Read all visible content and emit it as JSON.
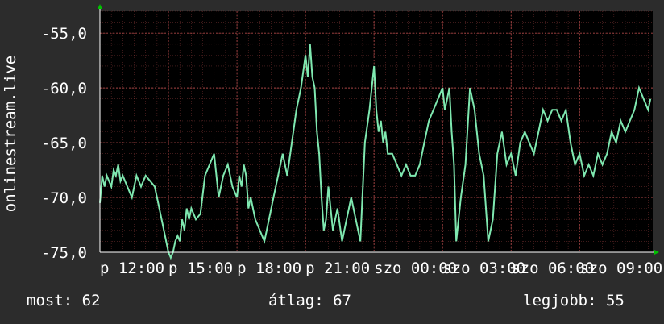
{
  "colors": {
    "background": "#2c2c2c",
    "plot_background": "#000000",
    "line": "#7fe8b0",
    "grid": "#b84c4c",
    "axis": "#ffffff",
    "arrow": "#00c000"
  },
  "stats": {
    "current": "most: 62",
    "average": "átlag: 67",
    "best": "legjobb: 55"
  },
  "chart_data": {
    "type": "line",
    "title": "",
    "xlabel": "",
    "ylabel": "onlinestream.live",
    "ylim": [
      -75,
      -53
    ],
    "y_ticks": [
      -55,
      -60,
      -65,
      -70,
      -75
    ],
    "y_tick_labels": [
      "-55,0",
      "-60,0",
      "-65,0",
      "-70,0",
      "-75,0"
    ],
    "x_tick_labels": [
      "p 12:00",
      "p 15:00",
      "p 18:00",
      "p 21:00",
      "szo 00:00",
      "szo 03:00",
      "szo 06:00",
      "szo 09:00"
    ],
    "x_tick_hours": [
      0,
      3,
      6,
      9,
      12,
      15,
      18,
      21
    ],
    "x_range_hours": [
      0,
      24.2
    ],
    "grid": true,
    "series": [
      {
        "name": "",
        "x_hours": [
          0,
          0.1,
          0.2,
          0.3,
          0.4,
          0.5,
          0.6,
          0.7,
          0.8,
          0.9,
          1.0,
          1.2,
          1.4,
          1.6,
          1.8,
          2.0,
          2.2,
          2.4,
          2.6,
          2.8,
          3.0,
          3.1,
          3.2,
          3.3,
          3.4,
          3.5,
          3.6,
          3.7,
          3.8,
          3.9,
          4.0,
          4.2,
          4.4,
          4.6,
          4.8,
          5.0,
          5.2,
          5.4,
          5.6,
          5.8,
          6.0,
          6.1,
          6.2,
          6.3,
          6.4,
          6.5,
          6.6,
          6.8,
          7.0,
          7.2,
          7.4,
          7.6,
          7.8,
          8.0,
          8.2,
          8.4,
          8.6,
          8.8,
          9.0,
          9.1,
          9.2,
          9.3,
          9.4,
          9.5,
          9.6,
          9.7,
          9.8,
          9.9,
          10.0,
          10.2,
          10.4,
          10.6,
          10.8,
          11.0,
          11.2,
          11.4,
          11.6,
          11.8,
          12.0,
          12.1,
          12.2,
          12.3,
          12.4,
          12.5,
          12.6,
          12.8,
          13.0,
          13.2,
          13.4,
          13.6,
          13.8,
          14.0,
          14.2,
          14.4,
          14.6,
          14.8,
          15.0,
          15.1,
          15.2,
          15.3,
          15.4,
          15.5,
          15.6,
          15.8,
          16.0,
          16.2,
          16.4,
          16.6,
          16.8,
          17.0,
          17.2,
          17.4,
          17.6,
          17.8,
          18.0,
          18.2,
          18.4,
          18.6,
          18.8,
          19.0,
          19.2,
          19.4,
          19.6,
          19.8,
          20.0,
          20.2,
          20.4,
          20.6,
          20.8,
          21.0,
          21.2,
          21.4,
          21.6,
          21.8,
          22.0,
          22.2,
          22.4,
          22.6,
          22.8,
          23.0,
          23.2,
          23.4,
          23.6,
          23.8,
          24.0,
          24.1
        ],
        "values": [
          -70.5,
          -68,
          -69,
          -68,
          -68.5,
          -69,
          -67.5,
          -68,
          -67,
          -68.5,
          -68,
          -69,
          -70,
          -68,
          -69,
          -68,
          -68.5,
          -69,
          -71,
          -73,
          -75,
          -75.5,
          -75,
          -74,
          -73.5,
          -74,
          -72,
          -73,
          -71,
          -72,
          -71,
          -72,
          -71.5,
          -68,
          -67,
          -66,
          -70,
          -68,
          -67,
          -69,
          -70,
          -68,
          -69,
          -67,
          -68,
          -71,
          -70,
          -72,
          -73,
          -74,
          -72,
          -70,
          -68,
          -66,
          -68,
          -65,
          -62,
          -60,
          -57,
          -59,
          -56,
          -59,
          -60,
          -64,
          -66,
          -70,
          -73,
          -72,
          -69,
          -73,
          -71,
          -74,
          -72,
          -70,
          -72,
          -74,
          -65,
          -62,
          -58,
          -62,
          -64,
          -63,
          -65,
          -64,
          -66,
          -66,
          -67,
          -68,
          -67,
          -68,
          -68,
          -67,
          -65,
          -63,
          -62,
          -61,
          -60,
          -62,
          -61,
          -60,
          -64,
          -67,
          -74,
          -70,
          -67,
          -60,
          -62,
          -66,
          -68,
          -74,
          -72,
          -66,
          -64,
          -67,
          -66,
          -68,
          -65,
          -64,
          -65,
          -66,
          -64,
          -62,
          -63,
          -62,
          -62,
          -63,
          -62,
          -65,
          -67,
          -66,
          -68,
          -67,
          -68,
          -66,
          -67,
          -66,
          -64,
          -65,
          -63,
          -64,
          -63,
          -62,
          -60,
          -61,
          -62,
          -61,
          -61.5,
          -62
        ]
      }
    ]
  }
}
